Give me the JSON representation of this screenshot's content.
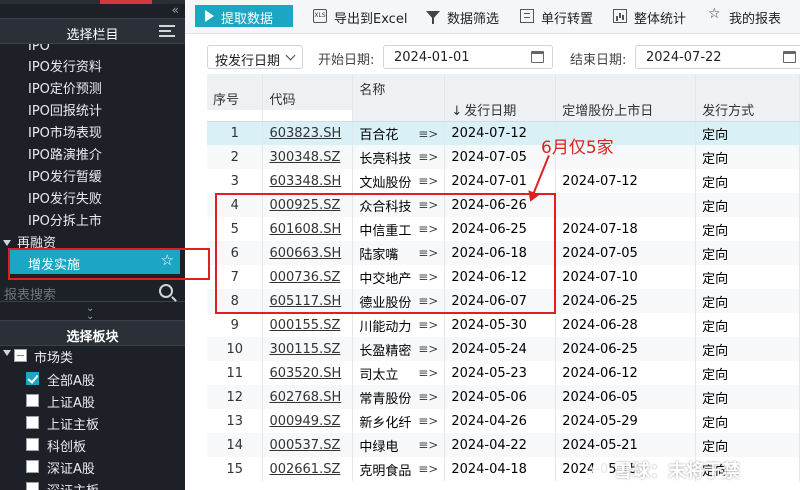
{
  "sidebar": {
    "header_title": "选择栏目",
    "ipo_partial": "IPO",
    "items": [
      "IPO发行资料",
      "IPO定价预测",
      "IPO回报统计",
      "IPO市场表现",
      "IPO路演推介",
      "IPO发行暂缓",
      "IPO发行失败",
      "IPO分拆上市"
    ],
    "section_refinance": "再融资",
    "active_item": "增发实施",
    "search_placeholder": "报表搜索",
    "board_header": "选择板块",
    "market_category": "市场类",
    "boards": [
      "全部A股",
      "上证A股",
      "上证主板",
      "科创板",
      "深证A股",
      "深证主板"
    ]
  },
  "toolbar": {
    "fetch": "提取数据",
    "export": "导出到Excel",
    "filter": "数据筛选",
    "transpose": "单行转置",
    "stats": "整体统计",
    "my_reports": "我的报表"
  },
  "filterbar": {
    "date_type": "按发行日期",
    "start_label": "开始日期:",
    "start_value": "2024-01-01",
    "end_label": "结束日期:",
    "end_value": "2024-07-22"
  },
  "table": {
    "headers": {
      "seq": "序号",
      "code": "代码",
      "name": "名称",
      "issue_date": "发行日期",
      "listing_date": "定增股份上市日",
      "method": "发行方式"
    },
    "sort_indicator": "↓",
    "rows": [
      {
        "seq": "1",
        "code": "603823.SH",
        "name": "百合花",
        "issue": "2024-07-12",
        "list": "",
        "method": "定向"
      },
      {
        "seq": "2",
        "code": "300348.SZ",
        "name": "长亮科技",
        "issue": "2024-07-05",
        "list": "",
        "method": "定向"
      },
      {
        "seq": "3",
        "code": "603348.SH",
        "name": "文灿股份",
        "issue": "2024-07-01",
        "list": "2024-07-12",
        "method": "定向"
      },
      {
        "seq": "4",
        "code": "000925.SZ",
        "name": "众合科技",
        "issue": "2024-06-26",
        "list": "",
        "method": "定向"
      },
      {
        "seq": "5",
        "code": "601608.SH",
        "name": "中信重工",
        "issue": "2024-06-25",
        "list": "2024-07-18",
        "method": "定向"
      },
      {
        "seq": "6",
        "code": "600663.SH",
        "name": "陆家嘴",
        "issue": "2024-06-18",
        "list": "2024-07-05",
        "method": "定向"
      },
      {
        "seq": "7",
        "code": "000736.SZ",
        "name": "中交地产",
        "issue": "2024-06-12",
        "list": "2024-07-10",
        "method": "定向"
      },
      {
        "seq": "8",
        "code": "605117.SH",
        "name": "德业股份",
        "issue": "2024-06-07",
        "list": "2024-06-25",
        "method": "定向"
      },
      {
        "seq": "9",
        "code": "000155.SZ",
        "name": "川能动力",
        "issue": "2024-05-30",
        "list": "2024-06-28",
        "method": "定向"
      },
      {
        "seq": "10",
        "code": "300115.SZ",
        "name": "长盈精密",
        "issue": "2024-05-24",
        "list": "2024-06-25",
        "method": "定向"
      },
      {
        "seq": "11",
        "code": "603520.SH",
        "name": "司太立",
        "issue": "2024-05-23",
        "list": "2024-06-12",
        "method": "定向"
      },
      {
        "seq": "12",
        "code": "602768.SH",
        "name": "常青股份",
        "issue": "2024-05-06",
        "list": "2024-06-05",
        "method": "定向"
      },
      {
        "seq": "13",
        "code": "000949.SZ",
        "name": "新乡化纤",
        "issue": "2024-04-26",
        "list": "2024-05-29",
        "method": "定向"
      },
      {
        "seq": "14",
        "code": "000537.SZ",
        "name": "中绿电",
        "issue": "2024-04-22",
        "list": "2024-05-21",
        "method": "定向"
      },
      {
        "seq": "15",
        "code": "002661.SZ",
        "name": "克明食品",
        "issue": "2024-04-18",
        "list": "2024-05-15",
        "method": "定向"
      }
    ]
  },
  "annotation": {
    "text": "6月仅5家"
  },
  "watermark": "雪球：末将于禁",
  "colors": {
    "accent": "#1ba7c4",
    "sidebar_bg": "#1d2127",
    "annotation_red": "#e02020"
  }
}
